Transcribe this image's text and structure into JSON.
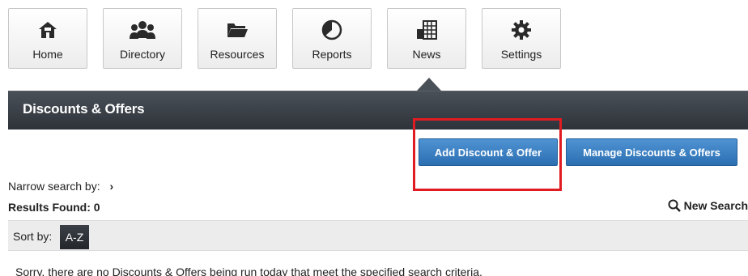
{
  "nav": {
    "items": [
      {
        "label": "Home",
        "icon": "home-icon"
      },
      {
        "label": "Directory",
        "icon": "people-icon"
      },
      {
        "label": "Resources",
        "icon": "folder-icon"
      },
      {
        "label": "Reports",
        "icon": "pie-chart-icon"
      },
      {
        "label": "News",
        "icon": "building-icon"
      },
      {
        "label": "Settings",
        "icon": "gear-icon"
      }
    ]
  },
  "header": {
    "title": "Discounts & Offers"
  },
  "actions": {
    "add_label": "Add Discount & Offer",
    "manage_label": "Manage Discounts & Offers"
  },
  "search": {
    "narrow_label": "Narrow search by:",
    "results_label": "Results Found: 0",
    "new_search_label": "New Search"
  },
  "sort": {
    "label": "Sort by:",
    "option": "A-Z"
  },
  "message": {
    "empty": "Sorry, there are no Discounts & Offers being run today that meet the specified search criteria."
  },
  "colors": {
    "header_bg": "#3a3f46",
    "button_blue": "#3a80c4",
    "highlight_red": "#e11b22"
  }
}
